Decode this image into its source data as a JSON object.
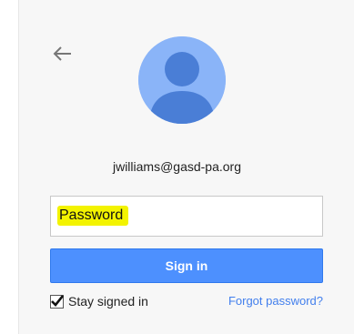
{
  "account": {
    "email": "jwilliams@gasd-pa.org"
  },
  "password_field": {
    "placeholder": "Password"
  },
  "buttons": {
    "sign_in": "Sign in"
  },
  "options": {
    "stay_signed_in_label": "Stay signed in",
    "stay_signed_in_checked": true,
    "forgot_password": "Forgot password?"
  },
  "icons": {
    "back": "back-arrow-icon",
    "avatar": "default-avatar-icon",
    "checkbox": "checkmark-icon"
  },
  "colors": {
    "primary_button": "#4d90fe",
    "link": "#427fed",
    "highlight": "#f3f300",
    "avatar_bg": "#8ab4f8",
    "avatar_fg": "#4a7ed6"
  }
}
